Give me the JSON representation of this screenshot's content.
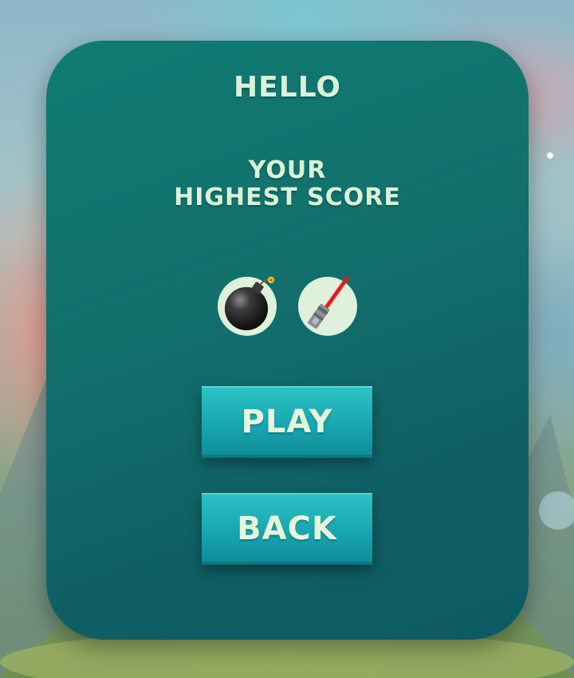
{
  "header": {
    "greeting": "HELLO"
  },
  "score": {
    "label_line1": "YOUR",
    "label_line2": "HIGHEST SCORE"
  },
  "powerups": [
    {
      "icon": "bomb-icon"
    },
    {
      "icon": "lightsaber-icon"
    }
  ],
  "buttons": {
    "play_label": "PLAY",
    "back_label": "BACK"
  },
  "colors": {
    "panel": "#0f6d6c",
    "text": "#d9f2d8",
    "button": "#17a6b0"
  }
}
